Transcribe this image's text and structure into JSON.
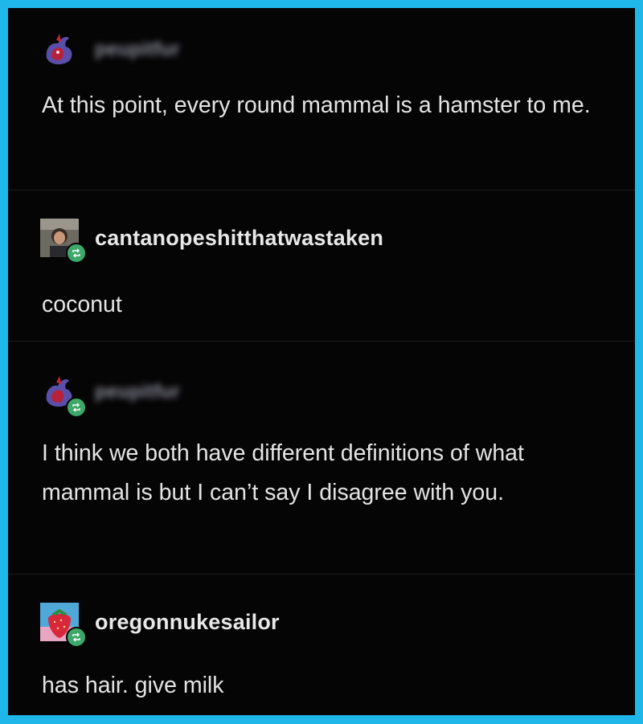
{
  "posts": [
    {
      "username": "peupitfur",
      "username_hidden": true,
      "avatar": "red-purple-creature-icon",
      "reblogged": false,
      "text": "At this point, every round mammal is a hamster to me."
    },
    {
      "username": "cantanopeshitthatwastaken",
      "username_hidden": false,
      "avatar": "person-photo-avatar",
      "reblogged": true,
      "text": "coconut"
    },
    {
      "username": "peupitfur",
      "username_hidden": true,
      "avatar": "red-purple-creature-icon",
      "reblogged": true,
      "text": "I think we both have different definitions of what mammal is but I can’t say I disagree with you."
    },
    {
      "username": "oregonnukesailor",
      "username_hidden": false,
      "avatar": "strawberry-avatar",
      "reblogged": true,
      "text": "has hair. give milk"
    }
  ],
  "colors": {
    "border": "#1fb6ea",
    "background": "#050505",
    "text": "#e4e4e4",
    "reblog_badge": "#3ea86a"
  }
}
